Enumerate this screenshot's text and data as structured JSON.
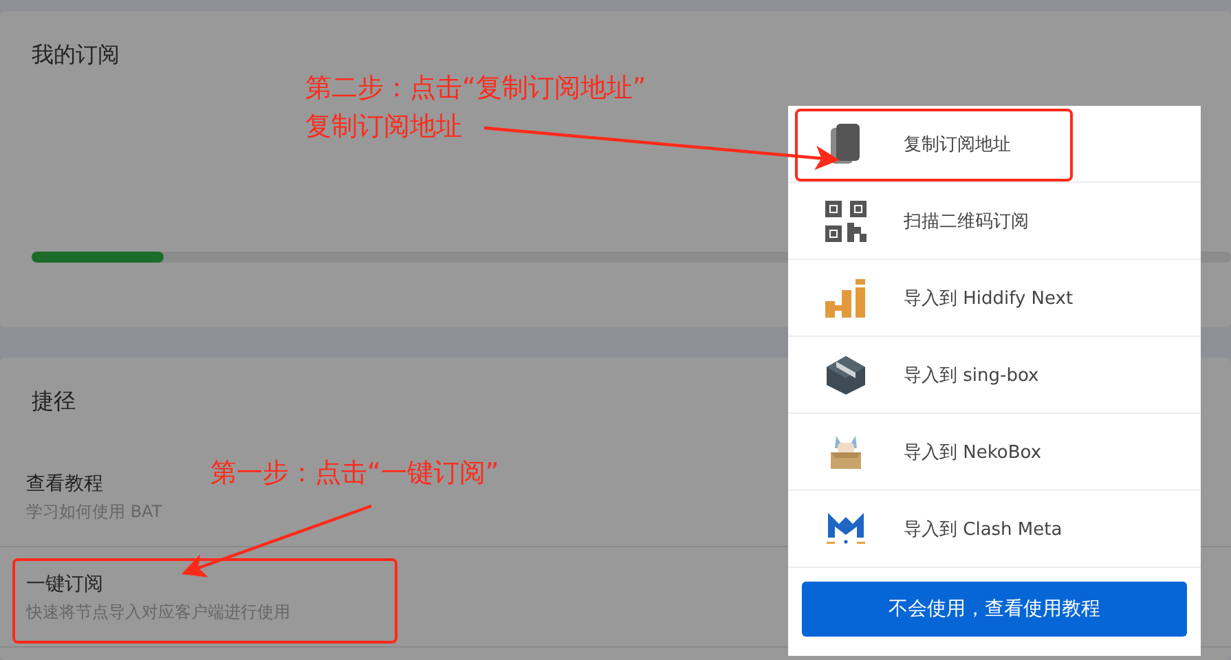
{
  "subscription": {
    "title": "我的订阅",
    "level": 0.11
  },
  "shortcuts": {
    "title": "捷径",
    "items": [
      {
        "title": "查看教程",
        "subtitle": "学习如何使用 BAT",
        "highlighted": false
      },
      {
        "title": "一键订阅",
        "subtitle": "快速将节点导入对应客户端进行使用",
        "highlighted": true
      }
    ]
  },
  "menu": {
    "items": [
      {
        "kind": "copy",
        "label": "复制订阅地址",
        "highlighted": true
      },
      {
        "kind": "qr",
        "label": "扫描二维码订阅",
        "highlighted": false
      },
      {
        "kind": "hiddify",
        "label": "导入到 Hiddify Next",
        "highlighted": false
      },
      {
        "kind": "box",
        "label": "导入到 sing-box",
        "highlighted": false
      },
      {
        "kind": "neko",
        "label": "导入到 NekoBox",
        "highlighted": false
      },
      {
        "kind": "clash",
        "label": "导入到 Clash Meta",
        "highlighted": false
      }
    ],
    "button": "不会使用，查看使用教程"
  },
  "annotations": {
    "step_two": [
      "第二步：点击“复制订阅地址”",
      "复制订阅地址"
    ],
    "step_one": "第一步：点击“一键订阅”"
  }
}
